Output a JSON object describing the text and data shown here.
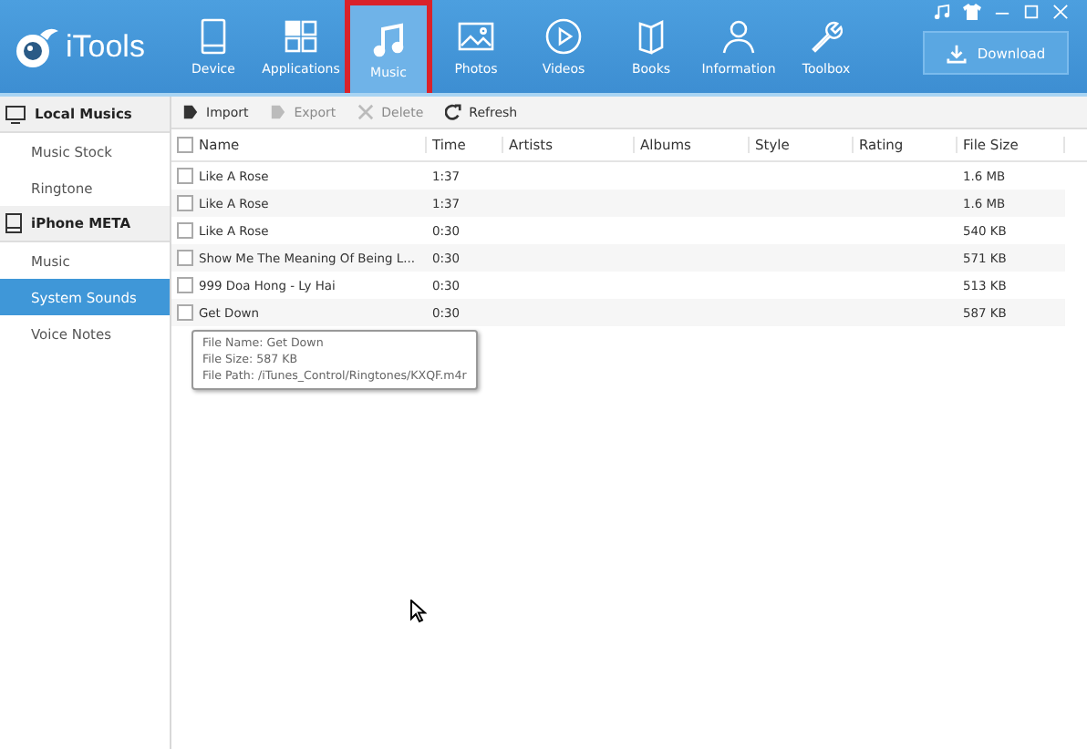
{
  "app": {
    "name": "iTools"
  },
  "nav": [
    {
      "label": "Device",
      "selected": false
    },
    {
      "label": "Applications",
      "selected": false
    },
    {
      "label": "Music",
      "selected": true
    },
    {
      "label": "Photos",
      "selected": false
    },
    {
      "label": "Videos",
      "selected": false
    },
    {
      "label": "Books",
      "selected": false
    },
    {
      "label": "Information",
      "selected": false
    },
    {
      "label": "Toolbox",
      "selected": false
    }
  ],
  "download_button": "Download",
  "sidebar": [
    {
      "kind": "header",
      "label": "Local Musics"
    },
    {
      "kind": "item",
      "label": "Music Stock",
      "selected": false
    },
    {
      "kind": "item",
      "label": "Ringtone",
      "selected": false
    },
    {
      "kind": "header",
      "label": "iPhone META"
    },
    {
      "kind": "item",
      "label": "Music",
      "selected": false
    },
    {
      "kind": "item",
      "label": "System Sounds",
      "selected": true
    },
    {
      "kind": "item",
      "label": "Voice Notes",
      "selected": false
    }
  ],
  "toolbar": [
    {
      "label": "Import",
      "disabled": false
    },
    {
      "label": "Export",
      "disabled": true
    },
    {
      "label": "Delete",
      "disabled": true
    },
    {
      "label": "Refresh",
      "disabled": false
    }
  ],
  "table": {
    "all_checked": false,
    "columns": [
      "Name",
      "Time",
      "Artists",
      "Albums",
      "Style",
      "Rating",
      "File Size"
    ],
    "rows": [
      {
        "checked": false,
        "cells": [
          "Like A Rose",
          "1:37",
          "",
          "",
          "",
          "",
          "1.6 MB"
        ]
      },
      {
        "checked": false,
        "cells": [
          "Like A Rose",
          "1:37",
          "",
          "",
          "",
          "",
          "1.6 MB"
        ]
      },
      {
        "checked": false,
        "cells": [
          "Like A Rose",
          "0:30",
          "",
          "",
          "",
          "",
          "540 KB"
        ]
      },
      {
        "checked": false,
        "cells": [
          "Show Me The Meaning Of Being L...",
          "0:30",
          "",
          "",
          "",
          "",
          "571 KB"
        ]
      },
      {
        "checked": false,
        "cells": [
          "999 Doa Hong - Ly Hai",
          "0:30",
          "",
          "",
          "",
          "",
          "513 KB"
        ]
      },
      {
        "checked": false,
        "cells": [
          "Get Down",
          "0:30",
          "",
          "",
          "",
          "",
          "587 KB"
        ]
      }
    ]
  },
  "tooltip": [
    "File Name: Get Down",
    "File Size: 587 KB",
    "File Path: /iTunes_Control/Ringtones/KXQF.m4r"
  ]
}
